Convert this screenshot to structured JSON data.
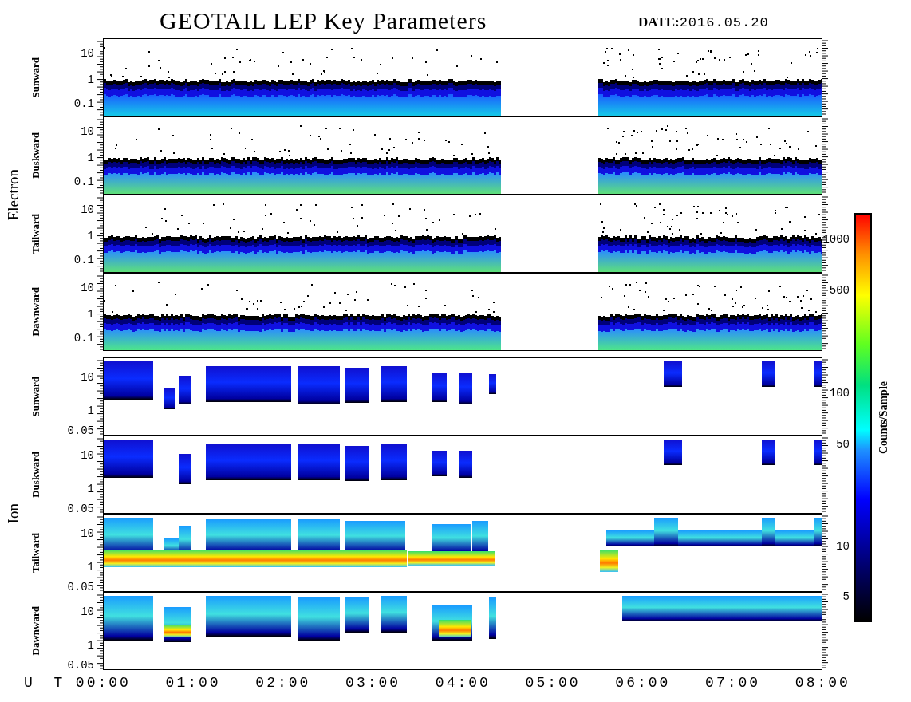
{
  "title": "GEOTAIL LEP Key Parameters",
  "date": {
    "label": "DATE:",
    "value": "2016.05.20"
  },
  "groups": [
    {
      "kind": "electron",
      "name": "Electron",
      "panels": [
        {
          "label": "Sunward",
          "yticks": [
            "10",
            "1",
            "0.1"
          ]
        },
        {
          "label": "Duskward",
          "yticks": [
            "10",
            "1",
            "0.1"
          ]
        },
        {
          "label": "Tailward",
          "yticks": [
            "10",
            "1",
            "0.1"
          ]
        },
        {
          "label": "Dawnward",
          "yticks": [
            "10",
            "1",
            "0.1"
          ]
        }
      ]
    },
    {
      "kind": "ion",
      "name": "Ion",
      "panels": [
        {
          "label": "Sunward",
          "yticks": [
            "10",
            "1",
            "0.05"
          ]
        },
        {
          "label": "Duskward",
          "yticks": [
            "10",
            "1",
            "0.05"
          ]
        },
        {
          "label": "Tailward",
          "yticks": [
            "10",
            "1",
            "0.05"
          ]
        },
        {
          "label": "Dawnward",
          "yticks": [
            "10",
            "1",
            "0.05"
          ]
        }
      ]
    }
  ],
  "x_axis": {
    "label": "U T",
    "ticks": [
      "00:00",
      "01:00",
      "02:00",
      "03:00",
      "04:00",
      "05:00",
      "06:00",
      "07:00",
      "08:00"
    ]
  },
  "colorbar": {
    "label": "Counts/Sample",
    "ticks": [
      "1000",
      "500",
      "100",
      "50",
      "10",
      "5"
    ]
  }
}
